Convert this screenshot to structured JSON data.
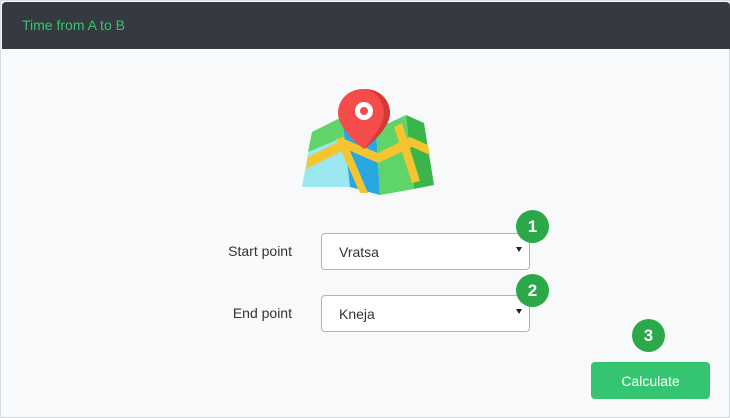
{
  "app": {
    "title": "Time from A to B"
  },
  "form": {
    "start": {
      "label": "Start point",
      "value": "Vratsa"
    },
    "end": {
      "label": "End point",
      "value": "Kneja"
    }
  },
  "steps": {
    "one": "1",
    "two": "2",
    "three": "3"
  },
  "actions": {
    "calculate_label": "Calculate"
  },
  "icons": {
    "map": "map-pin-icon",
    "dropdown": "chevron-down-icon"
  },
  "colors": {
    "accent": "#35c46f",
    "badge": "#2ba84a",
    "titlebar": "#343a40",
    "pin": "#f44b4b"
  }
}
